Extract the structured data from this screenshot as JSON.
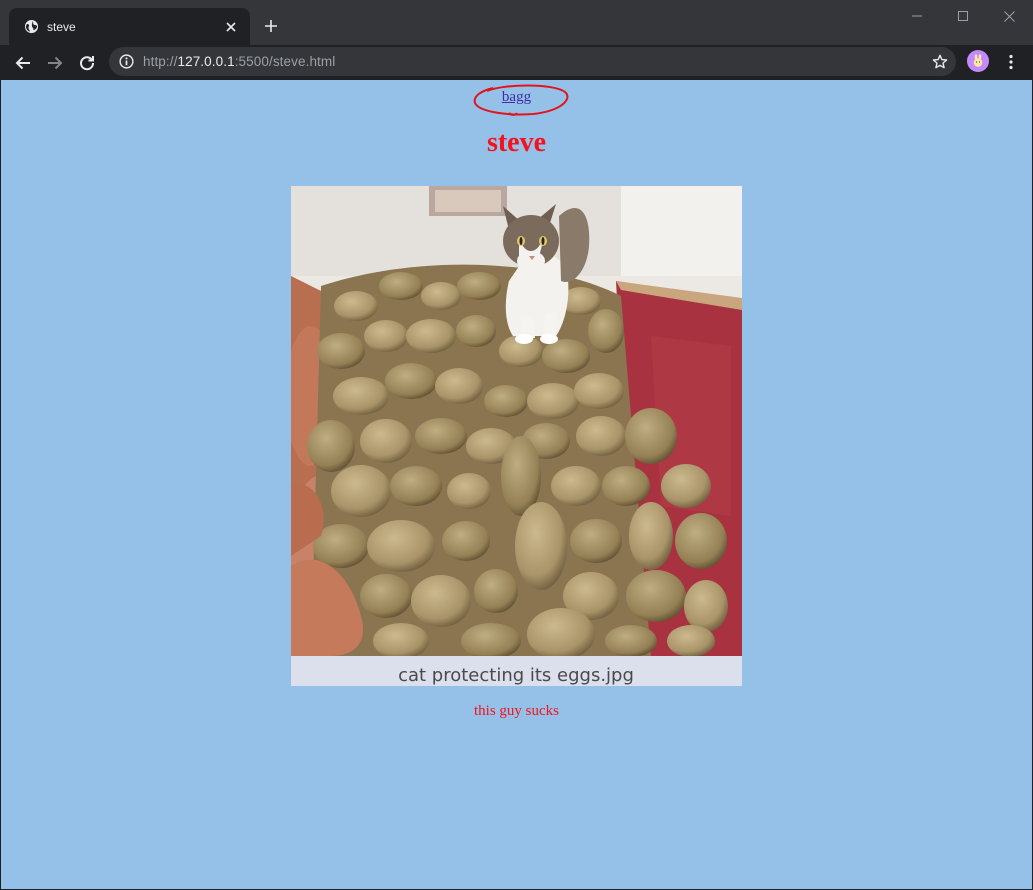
{
  "browser": {
    "tab": {
      "title": "steve",
      "favicon": "globe-icon"
    },
    "url": {
      "scheme": "http://",
      "host": "127.0.0.1",
      "rest": ":5500/steve.html"
    }
  },
  "page": {
    "link_text": "bagg",
    "heading": "steve",
    "image_caption": "cat protecting its eggs.jpg",
    "caption": "this guy sucks"
  },
  "colors": {
    "page_background": "#95c1e9",
    "heading": "#f4131d",
    "link": "#3d2aa8",
    "annotation_circle": "#e0141c"
  }
}
